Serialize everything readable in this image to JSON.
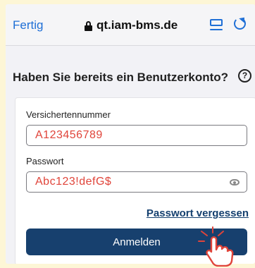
{
  "browser": {
    "done_label": "Fertig",
    "url": "qt.iam-bms.de",
    "icons": [
      "lock-icon",
      "reader-icon",
      "reload-icon"
    ]
  },
  "page": {
    "heading": "Haben Sie bereits ein Benutzerkonto?",
    "help_icon": "?"
  },
  "form": {
    "insurance_label": "Versichertennummer",
    "insurance_value": "A123456789",
    "password_label": "Passwort",
    "password_value": "Abc123!defG$",
    "forgot_label": "Passwort vergessen",
    "login_label": "Anmelden"
  },
  "colors": {
    "accent": "#1f6fd6",
    "primary_button": "#17406e",
    "input_text": "#e0443a",
    "background": "#fdf6d6"
  }
}
